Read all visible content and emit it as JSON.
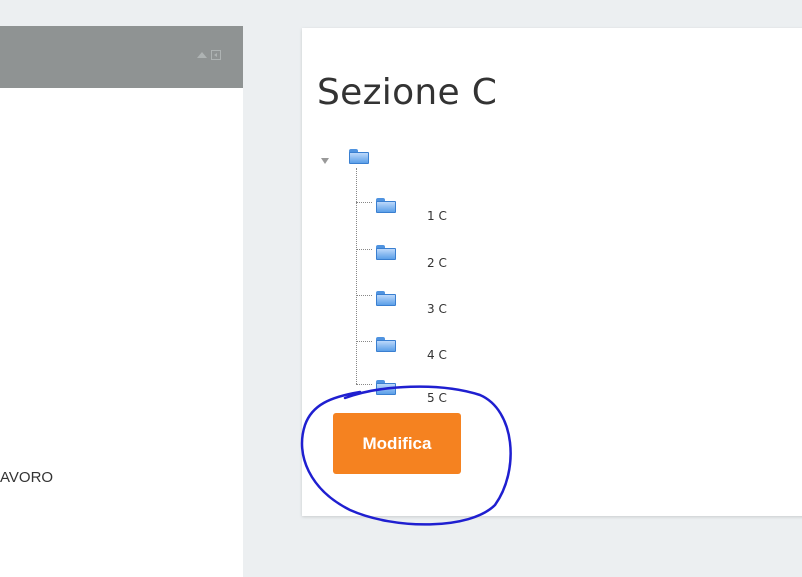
{
  "left_panel": {
    "visible_text": "AVORO",
    "header_icons": [
      "collapse-up-icon",
      "panel-toggle-icon"
    ]
  },
  "section": {
    "title": "Sezione C",
    "tree": {
      "root_icon": "folder-icon",
      "items": [
        {
          "label": "1 C",
          "icon": "folder-icon"
        },
        {
          "label": "2 C",
          "icon": "folder-icon"
        },
        {
          "label": "3 C",
          "icon": "folder-icon"
        },
        {
          "label": "4 C",
          "icon": "folder-icon"
        },
        {
          "label": "5 C",
          "icon": "folder-icon"
        }
      ]
    },
    "modifica_label": "Modifica"
  },
  "colors": {
    "header_bg": "#8f9393",
    "button_bg": "#f58220",
    "annotation": "#1f1fd0"
  }
}
